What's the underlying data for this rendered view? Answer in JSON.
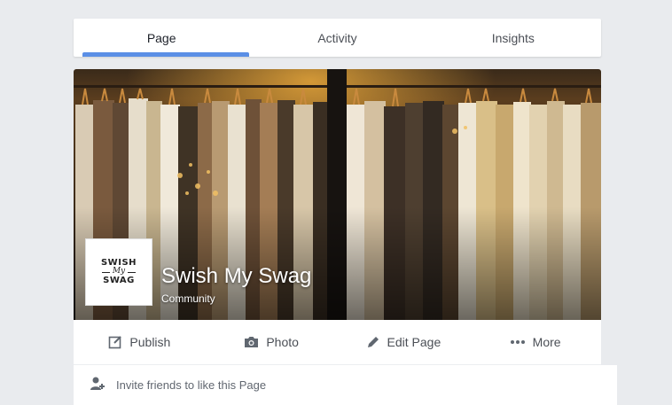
{
  "tabs": [
    {
      "label": "Page",
      "active": true
    },
    {
      "label": "Activity",
      "active": false
    },
    {
      "label": "Insights",
      "active": false
    }
  ],
  "page": {
    "name": "Swish My Swag",
    "category": "Community",
    "logo": {
      "top": "SWISH",
      "middle": "My",
      "bottom": "SWAG"
    }
  },
  "actions": {
    "publish": "Publish",
    "photo": "Photo",
    "edit_page": "Edit Page",
    "more": "More"
  },
  "invite": {
    "text": "Invite friends to like this Page"
  },
  "colors": {
    "background": "#e9ebee",
    "active_tab_underline": "#5b8fe6",
    "text_primary": "#1d2129",
    "text_secondary": "#4b4f56"
  },
  "icons": {
    "publish": "pencil-square-icon",
    "photo": "camera-icon",
    "edit": "pencil-icon",
    "more": "ellipsis-icon",
    "invite": "add-person-icon"
  }
}
